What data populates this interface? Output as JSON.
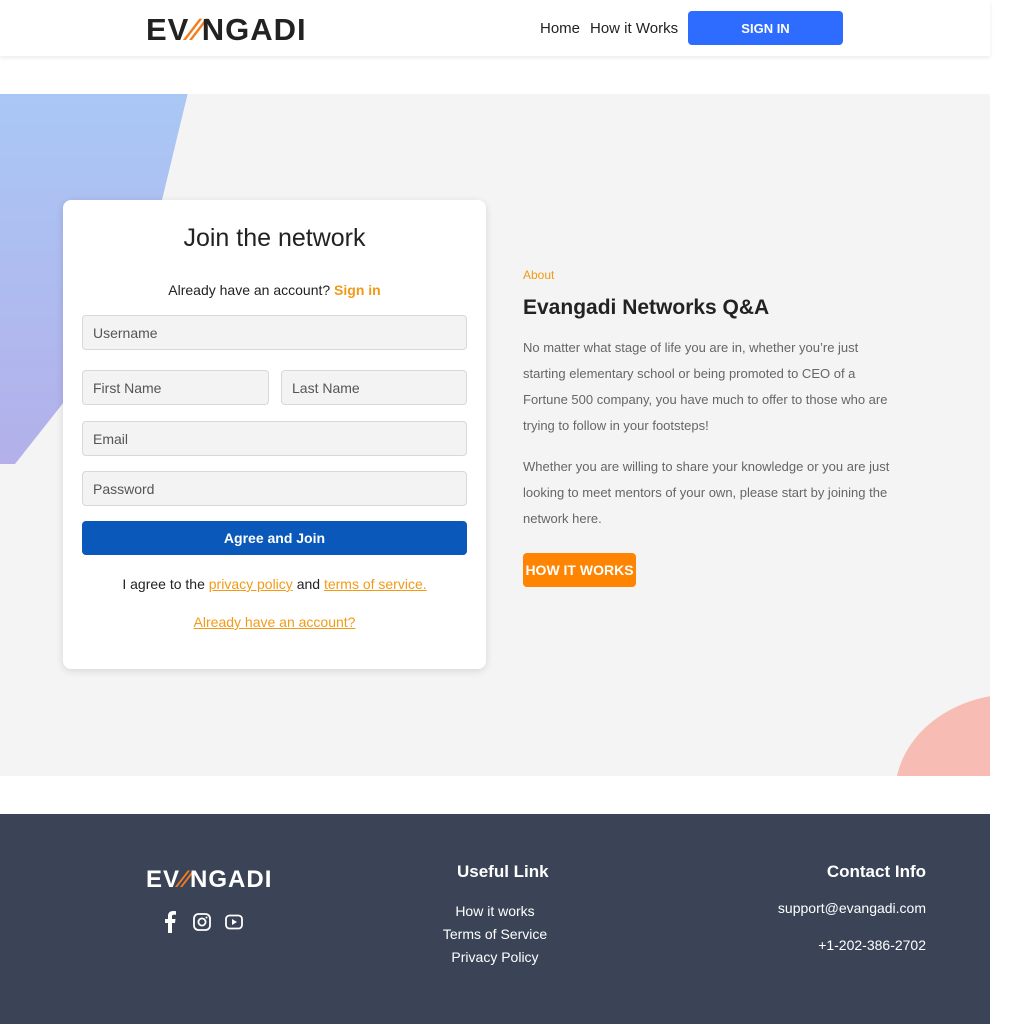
{
  "header": {
    "logo_part1": "EV",
    "logo_part2": "∕∕",
    "logo_part3": "NGADI",
    "nav": {
      "home": "Home",
      "how": "How it Works"
    },
    "signin_label": "SIGN IN"
  },
  "join_card": {
    "title": "Join the network",
    "sub_prefix": "Already have an account?",
    "sub_link": "Sign in",
    "username_placeholder": "Username",
    "first_name_placeholder": "First Name",
    "last_name_placeholder": "Last Name",
    "email_placeholder": "Email",
    "password_placeholder": "Password",
    "join_button": "Agree and Join",
    "agree_prefix": "I agree to the",
    "privacy_link": "privacy policy",
    "agree_and": "and",
    "terms_link": "terms of service.",
    "already_link": "Already have an account?"
  },
  "about": {
    "label": "About",
    "title": "Evangadi Networks Q&A",
    "paragraph1": "No matter what stage of life you are in, whether you’re just starting elementary school or being promoted to CEO of a Fortune 500 company, you have much to offer to those who are trying to follow in your footsteps!",
    "paragraph2": "Whether you are willing to share your knowledge or you are just looking to meet mentors of your own, please start by joining the network here.",
    "button": "HOW IT WORKS"
  },
  "footer": {
    "socials": [
      "facebook-icon",
      "instagram-icon",
      "youtube-icon"
    ],
    "useful_title": "Useful Link",
    "useful_links": [
      "How it works",
      "Terms of Service",
      "Privacy Policy"
    ],
    "contact_title": "Contact Info",
    "email": "support@evangadi.com",
    "phone": "+1-202-386-2702"
  },
  "colors": {
    "primary_blue": "#2d6cff",
    "join_blue": "#0a58ba",
    "orange": "#fe8402",
    "link_orange": "#f29a17",
    "footer_bg": "#3b4456"
  }
}
